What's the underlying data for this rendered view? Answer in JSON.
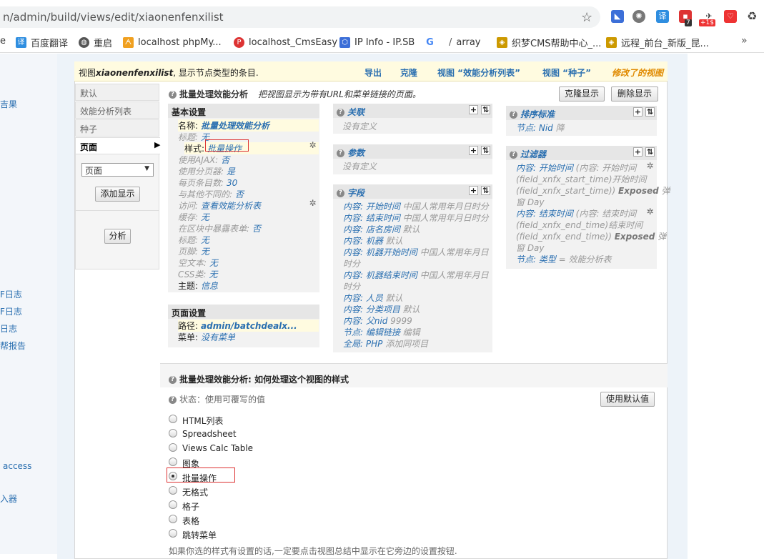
{
  "browser": {
    "url": "n/admin/build/views/edit/xiaonenfenxilist",
    "bookmarks": [
      "百度翻译",
      "重启",
      "localhost phpMy...",
      "localhost_CmsEasy",
      "IP Info - IP.SB",
      "array",
      "织梦CMS帮助中心_...",
      "远程_前台_新版_昆..."
    ],
    "ext_badges": [
      "7",
      "+1$"
    ]
  },
  "left_links": [
    "吉果",
    "F日志",
    "F日志",
    "日志",
    "帮报告",
    "access",
    "入器"
  ],
  "topbar": {
    "prefix": "视图",
    "view_name": "xiaonenfenxilist",
    "suffix": ", 显示节点类型的条目.",
    "links": [
      "导出",
      "克隆",
      "视图 “效能分析列表”",
      "视图 “种子”"
    ],
    "modified": "修改了的视图"
  },
  "tabs": [
    "默认",
    "效能分析列表",
    "种子",
    "页面"
  ],
  "tabpanel": {
    "select_value": "页面",
    "add_display": "添加显示",
    "analyze": "分析"
  },
  "header": {
    "title": "批量处理效能分析",
    "desc": "把视图显示为带有URL和菜单链接的页面。",
    "clone_btn": "克隆显示",
    "delete_btn": "删除显示"
  },
  "basic": {
    "title": "基本设置",
    "rows": [
      {
        "k": "名称:",
        "v": "批量处理效能分析"
      },
      {
        "k": "标题:",
        "v": "无"
      },
      {
        "k": "样式:",
        "v": "批量操作"
      },
      {
        "k": "使用AJAX:",
        "v": "否"
      },
      {
        "k": "使用分页器:",
        "v": "是"
      },
      {
        "k": "每页条目数:",
        "v": "30"
      },
      {
        "k": "与其他不同的:",
        "v": "否"
      },
      {
        "k": "访问:",
        "v": "查看效能分析表"
      },
      {
        "k": "缓存:",
        "v": "无"
      },
      {
        "k": "在区块中暴露表单:",
        "v": "否"
      },
      {
        "k": "标题:",
        "v": "无"
      },
      {
        "k": "页脚:",
        "v": "无"
      },
      {
        "k": "空文本:",
        "v": "无"
      },
      {
        "k": "CSS类:",
        "v": "无"
      },
      {
        "k": "主题:",
        "v": "信息"
      }
    ]
  },
  "page_settings": {
    "title": "页面设置",
    "rows": [
      {
        "k": "路径:",
        "v": "admin/batchdealx..."
      },
      {
        "k": "菜单:",
        "v": "没有菜单"
      }
    ]
  },
  "relations": {
    "title": "关联",
    "empty": "没有定义"
  },
  "arguments": {
    "title": "参数",
    "empty": "没有定义"
  },
  "fields": {
    "title": "字段",
    "lines": [
      [
        "内容: 开始时间",
        " 中国人常用年月日时分"
      ],
      [
        "内容: 结束时间",
        " 中国人常用年月日时分"
      ],
      [
        "内容: 店名房间",
        " 默认"
      ],
      [
        "内容: 机器",
        " 默认"
      ],
      [
        "内容: 机器开始时间",
        " 中国人常用年月日"
      ],
      [
        "",
        "时分"
      ],
      [
        "内容: 机器结束时间",
        " 中国人常用年月日"
      ],
      [
        "",
        "时分"
      ],
      [
        "内容: 人员",
        " 默认"
      ],
      [
        "内容: 分类项目",
        " 默认"
      ],
      [
        "内容: 父nid",
        " 9999"
      ],
      [
        "节点: 编辑链接",
        " 编辑"
      ],
      [
        "全局: PHP",
        " 添加同项目"
      ]
    ]
  },
  "sort": {
    "title": "排序标准",
    "line": [
      "节点: Nid",
      " 降"
    ]
  },
  "filters": {
    "title": "过滤器",
    "lines": [
      [
        "内容: 开始时间",
        " (内容: 开始时间"
      ],
      [
        "",
        "(field_xnfx_start_time)开始时间"
      ],
      [
        "",
        "(field_xnfx_start_time)) "
      ],
      [
        "",
        "窗 Day"
      ],
      [
        "内容: 结束时间",
        " (内容: 结束时间"
      ],
      [
        "",
        "(field_xnfx_end_time)结束时间"
      ],
      [
        "",
        "(field_xnfx_end_time)) "
      ],
      [
        "",
        "窗 Day"
      ],
      [
        "节点: 类型",
        " = 效能分析表"
      ]
    ],
    "exposed": "Exposed",
    "popup": " 弹"
  },
  "style_section": {
    "title": "批量处理效能分析: 如何处理这个视图的样式",
    "status": "状态：使用可覆写的值",
    "default_btn": "使用默认值",
    "options": [
      "HTML列表",
      "Spreadsheet",
      "Views Calc Table",
      "图象",
      "批量操作",
      "无格式",
      "格子",
      "表格",
      "跳转菜单"
    ],
    "selected": "批量操作",
    "footer": "如果你选的样式有设置的话,一定要点击视图总结中显示在它旁边的设置按钮."
  }
}
